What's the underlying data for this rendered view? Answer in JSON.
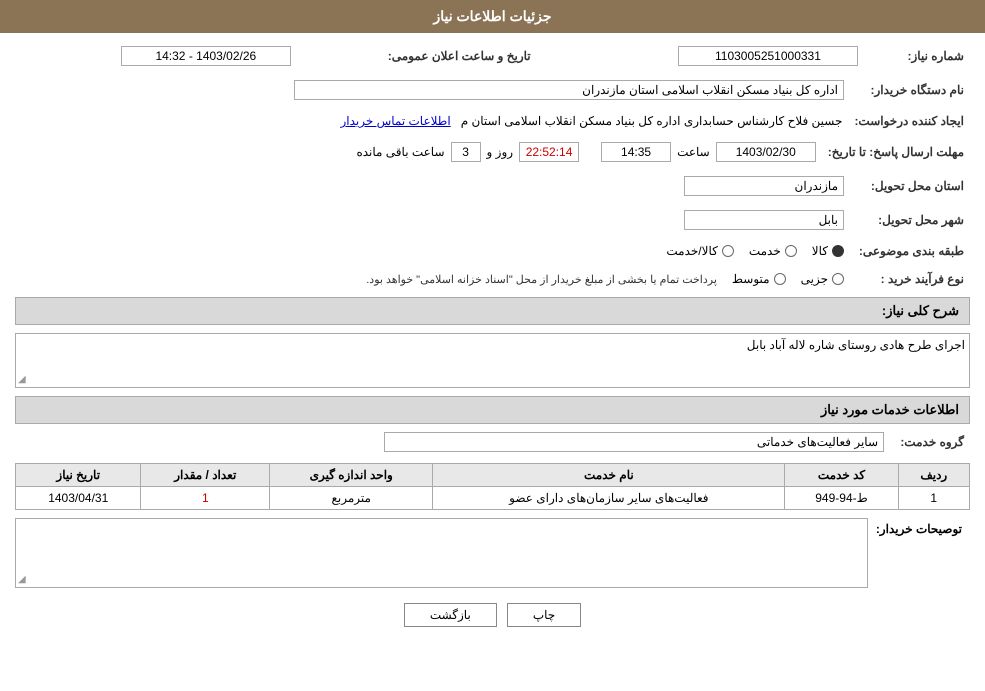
{
  "header": {
    "title": "جزئیات اطلاعات نیاز"
  },
  "fields": {
    "tender_number_label": "شماره نیاز:",
    "tender_number_value": "1103005251000331",
    "buyer_label": "نام دستگاه خریدار:",
    "buyer_value": "اداره کل بنیاد مسکن انقلاب اسلامی استان مازندران",
    "date_label": "تاریخ و ساعت اعلان عمومی:",
    "date_value": "1403/02/26 - 14:32",
    "creator_label": "ایجاد کننده درخواست:",
    "creator_value": "جسین فلاح کارشناس حسابداری اداره کل بنیاد مسکن انقلاب اسلامی استان م",
    "contact_link": "اطلاعات تماس خریدار",
    "deadline_label": "مهلت ارسال پاسخ: تا تاریخ:",
    "deadline_date": "1403/02/30",
    "deadline_time_label": "ساعت",
    "deadline_time": "14:35",
    "deadline_days_label": "روز و",
    "deadline_days": "3",
    "deadline_seconds": "22:52:14",
    "deadline_remaining_label": "ساعت باقی مانده",
    "province_label": "استان محل تحویل:",
    "province_value": "مازندران",
    "city_label": "شهر محل تحویل:",
    "city_value": "بابل",
    "category_label": "طبقه بندی موضوعی:",
    "category_options": [
      {
        "label": "کالا",
        "selected": true
      },
      {
        "label": "خدمت",
        "selected": false
      },
      {
        "label": "کالا/خدمت",
        "selected": false
      }
    ],
    "process_label": "نوع فرآیند خرید :",
    "process_options": [
      {
        "label": "جزیی",
        "selected": false
      },
      {
        "label": "متوسط",
        "selected": false
      }
    ],
    "process_note": "پرداخت تمام یا بخشی از مبلغ خریدار از محل \"اسناد خزانه اسلامی\" خواهد بود.",
    "description_section_label": "شرح کلی نیاز:",
    "description_value": "اجرای طرح هادی روستای شاره لاله آباد بابل",
    "services_section_label": "اطلاعات خدمات مورد نیاز",
    "service_group_label": "گروه خدمت:",
    "service_group_value": "سایر فعالیت‌های خدماتی",
    "table_headers": {
      "row_num": "ردیف",
      "service_code": "کد خدمت",
      "service_name": "نام خدمت",
      "unit": "واحد اندازه گیری",
      "quantity": "تعداد / مقدار",
      "date": "تاریخ نیاز"
    },
    "table_rows": [
      {
        "row": "1",
        "code": "ط-94-949",
        "name": "فعالیت‌های سایر سازمان‌های دارای عضو",
        "unit": "مترمربع",
        "quantity": "1",
        "date": "1403/04/31"
      }
    ],
    "buyer_description_label": "توصیحات خریدار:",
    "buyer_description_value": ""
  },
  "buttons": {
    "print": "چاپ",
    "back": "بازگشت"
  }
}
